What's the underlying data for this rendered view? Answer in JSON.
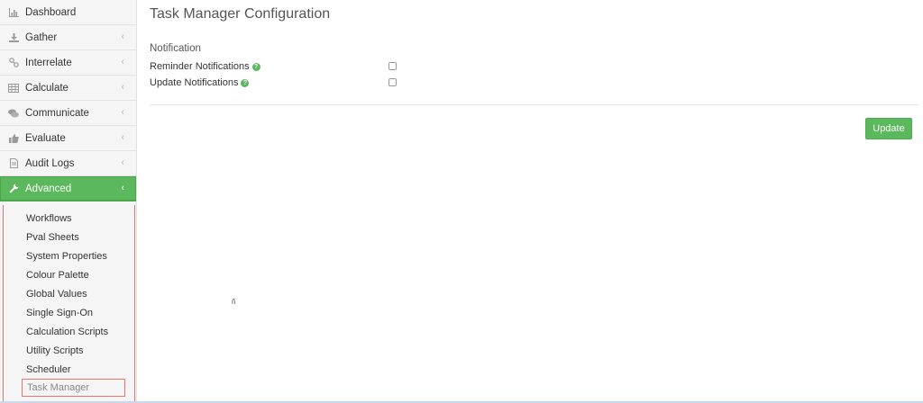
{
  "sidebar": {
    "items": [
      {
        "label": "Dashboard",
        "icon": "bar-chart-icon",
        "chevron": false
      },
      {
        "label": "Gather",
        "icon": "download-icon",
        "chevron": true
      },
      {
        "label": "Interrelate",
        "icon": "link-icon",
        "chevron": true
      },
      {
        "label": "Calculate",
        "icon": "table-icon",
        "chevron": true
      },
      {
        "label": "Communicate",
        "icon": "comments-icon",
        "chevron": true
      },
      {
        "label": "Evaluate",
        "icon": "thumbs-up-icon",
        "chevron": true
      },
      {
        "label": "Audit Logs",
        "icon": "document-icon",
        "chevron": true
      },
      {
        "label": "Advanced",
        "icon": "wrench-icon",
        "chevron": true,
        "active": true
      }
    ],
    "chevron_glyph": "‹",
    "submenu": [
      "Workflows",
      "Pval Sheets",
      "System Properties",
      "Colour Palette",
      "Global Values",
      "Single Sign-On",
      "Calculation Scripts",
      "Utility Scripts",
      "Scheduler",
      "Task Manager"
    ]
  },
  "main": {
    "title": "Task Manager Configuration",
    "section_label": "Notification",
    "settings": [
      {
        "label": "Reminder Notifications",
        "checked": false
      },
      {
        "label": "Update Notifications",
        "checked": false
      }
    ],
    "help_glyph": "?",
    "update_button": "Update",
    "stray_mark": "ñ"
  },
  "colors": {
    "accent": "#5cb85c",
    "highlight_border": "#e57373"
  }
}
